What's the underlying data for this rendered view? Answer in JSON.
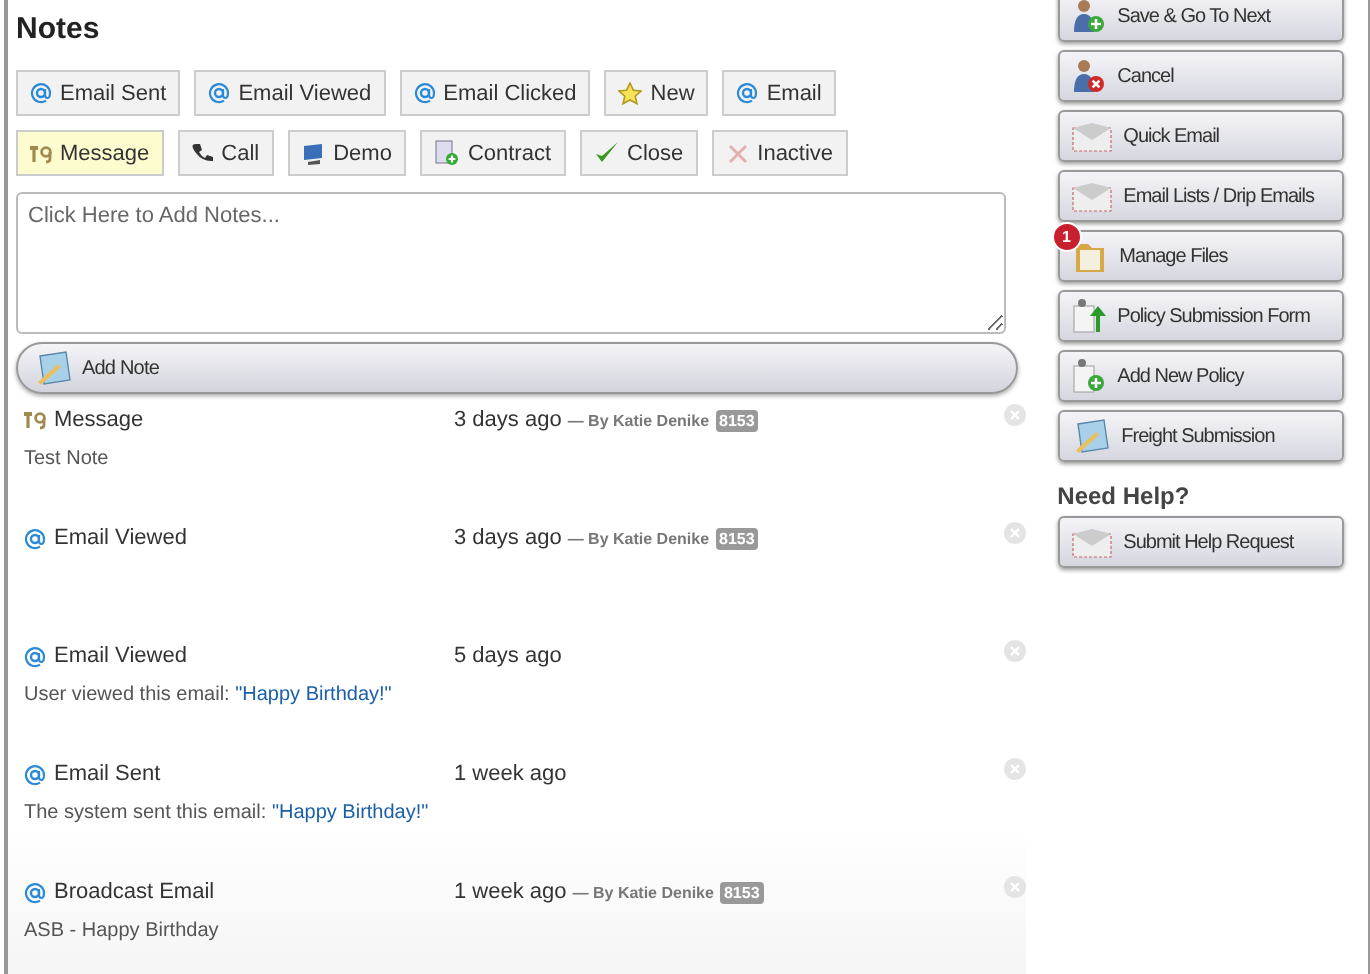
{
  "title": "Notes",
  "filters": [
    {
      "label": "Email Sent",
      "kind": "at",
      "selected": false
    },
    {
      "label": "Email Viewed",
      "kind": "at",
      "selected": false
    },
    {
      "label": "Email Clicked",
      "kind": "at",
      "selected": false
    },
    {
      "label": "New",
      "kind": "star",
      "selected": false
    },
    {
      "label": "Email",
      "kind": "at",
      "selected": false
    },
    {
      "label": "Message",
      "kind": "t9",
      "selected": true
    },
    {
      "label": "Call",
      "kind": "phone",
      "selected": false
    },
    {
      "label": "Demo",
      "kind": "monitor",
      "selected": false
    },
    {
      "label": "Contract",
      "kind": "contract",
      "selected": false
    },
    {
      "label": "Close",
      "kind": "check",
      "selected": false
    },
    {
      "label": "Inactive",
      "kind": "cross",
      "selected": false
    }
  ],
  "note_field": {
    "placeholder": "Click Here to Add Notes..."
  },
  "add_note": "Add Note",
  "notes": [
    {
      "kind": "t9",
      "type": "Message",
      "time": "3 days ago",
      "author": "— By Katie Denike",
      "badge": "8153",
      "body": "Test Note"
    },
    {
      "kind": "at",
      "type": "Email Viewed",
      "time": "3 days ago",
      "author": "— By Katie Denike",
      "badge": "8153"
    },
    {
      "kind": "at",
      "type": "Email Viewed",
      "time": "5 days ago",
      "body": "User viewed this email: ",
      "link": "\"Happy Birthday!\""
    },
    {
      "kind": "at",
      "type": "Email Sent",
      "time": "1 week ago",
      "body": "The system sent this email: ",
      "link": "\"Happy Birthday!\""
    },
    {
      "kind": "at",
      "type": "Broadcast Email",
      "time": "1 week ago",
      "author": "— By Katie Denike",
      "badge": "8153",
      "body": "ASB - Happy Birthday"
    }
  ],
  "actions": [
    {
      "label": "Save & Go To Next",
      "kind": "person-add"
    },
    {
      "label": "Cancel",
      "kind": "person-remove"
    },
    {
      "label": "Quick Email",
      "kind": "envelope"
    },
    {
      "label": "Email Lists / Drip Emails",
      "kind": "envelope"
    },
    {
      "label": "Manage Files",
      "kind": "folder",
      "badge": "1"
    },
    {
      "label": "Policy Submission Form",
      "kind": "doc-up"
    },
    {
      "label": "Add New Policy",
      "kind": "doc-add"
    },
    {
      "label": "Freight Submission",
      "kind": "notepad"
    }
  ],
  "help": {
    "heading": "Need Help?",
    "button": {
      "label": "Submit Help Request",
      "kind": "envelope"
    }
  }
}
